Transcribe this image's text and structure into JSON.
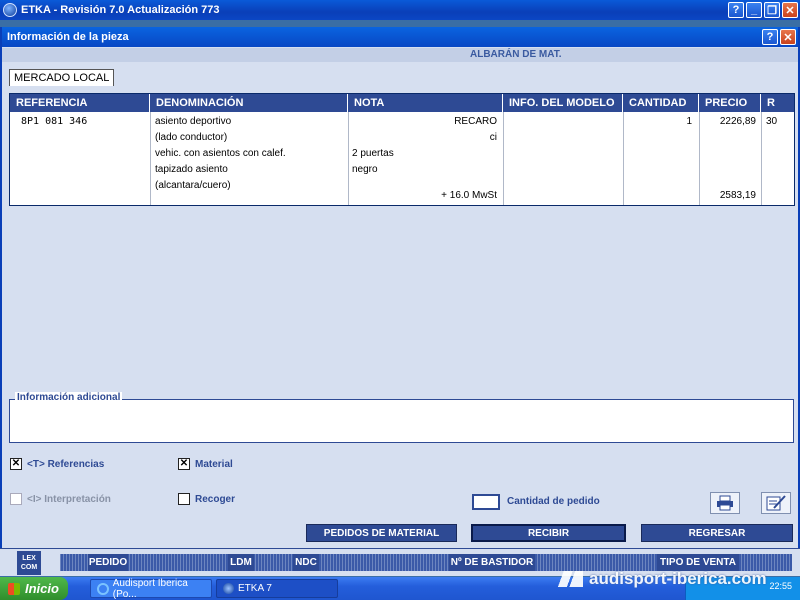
{
  "app": {
    "title": "ETKA - Revisión 7.0 Actualización 773"
  },
  "window_buttons": {
    "help": "?",
    "minimize": "_",
    "restore": "❐",
    "close": "✕"
  },
  "dialog": {
    "title": "Información de la pieza",
    "subheader": "ALBARÁN DE MAT."
  },
  "tab": {
    "label": "MERCADO LOCAL"
  },
  "table": {
    "headers": [
      "REFERENCIA",
      "DENOMINACIÓN",
      "NOTA",
      "INFO. DEL MODELO",
      "CANTIDAD",
      "PRECIO",
      "R"
    ],
    "row": {
      "referencia": "8P1 081 346",
      "denominacion": [
        "asiento deportivo",
        "(lado conductor)",
        "vehic. con asientos con calef.",
        "tapizado asiento",
        "(alcantara/cuero)"
      ],
      "nota_right": [
        "RECARO",
        "ci"
      ],
      "nota_left": [
        "2 puertas",
        "negro"
      ],
      "nota_tax": "+ 16.0 MwSt",
      "cantidad": "1",
      "precio": "2226,89",
      "precio_total": "2583,19",
      "r": "30"
    }
  },
  "info_adicional": {
    "label": "Información adicional"
  },
  "options": {
    "referencias": {
      "label": "<T> Referencias",
      "checked": true
    },
    "material": {
      "label": "Material",
      "checked": true
    },
    "interpretacion": {
      "label": "<I> Interpretación",
      "checked": false
    },
    "recoger": {
      "label": "Recoger",
      "checked": false
    },
    "cantidad_pedido": {
      "label": "Cantidad de pedido",
      "value": ""
    }
  },
  "actions": {
    "pedidos": "PEDIDOS DE MATERIAL",
    "recibir": "RECIBIR",
    "regresar": "REGRESAR"
  },
  "navbar": {
    "logo": "LEX COM",
    "items": [
      "PEDIDO",
      "LDM",
      "NDC",
      "Nº DE BASTIDOR",
      "TIPO DE VENTA"
    ]
  },
  "taskbar": {
    "start": "Inicio",
    "tasks": [
      "Audisport Iberica (Po...",
      "ETKA 7"
    ],
    "watermark": "audisport-iberica.com",
    "clock": "22:55"
  },
  "colors": {
    "header_blue": "#2e4a94",
    "dialog_bg": "#d6dff0",
    "title_blue": "#0a47c4"
  }
}
